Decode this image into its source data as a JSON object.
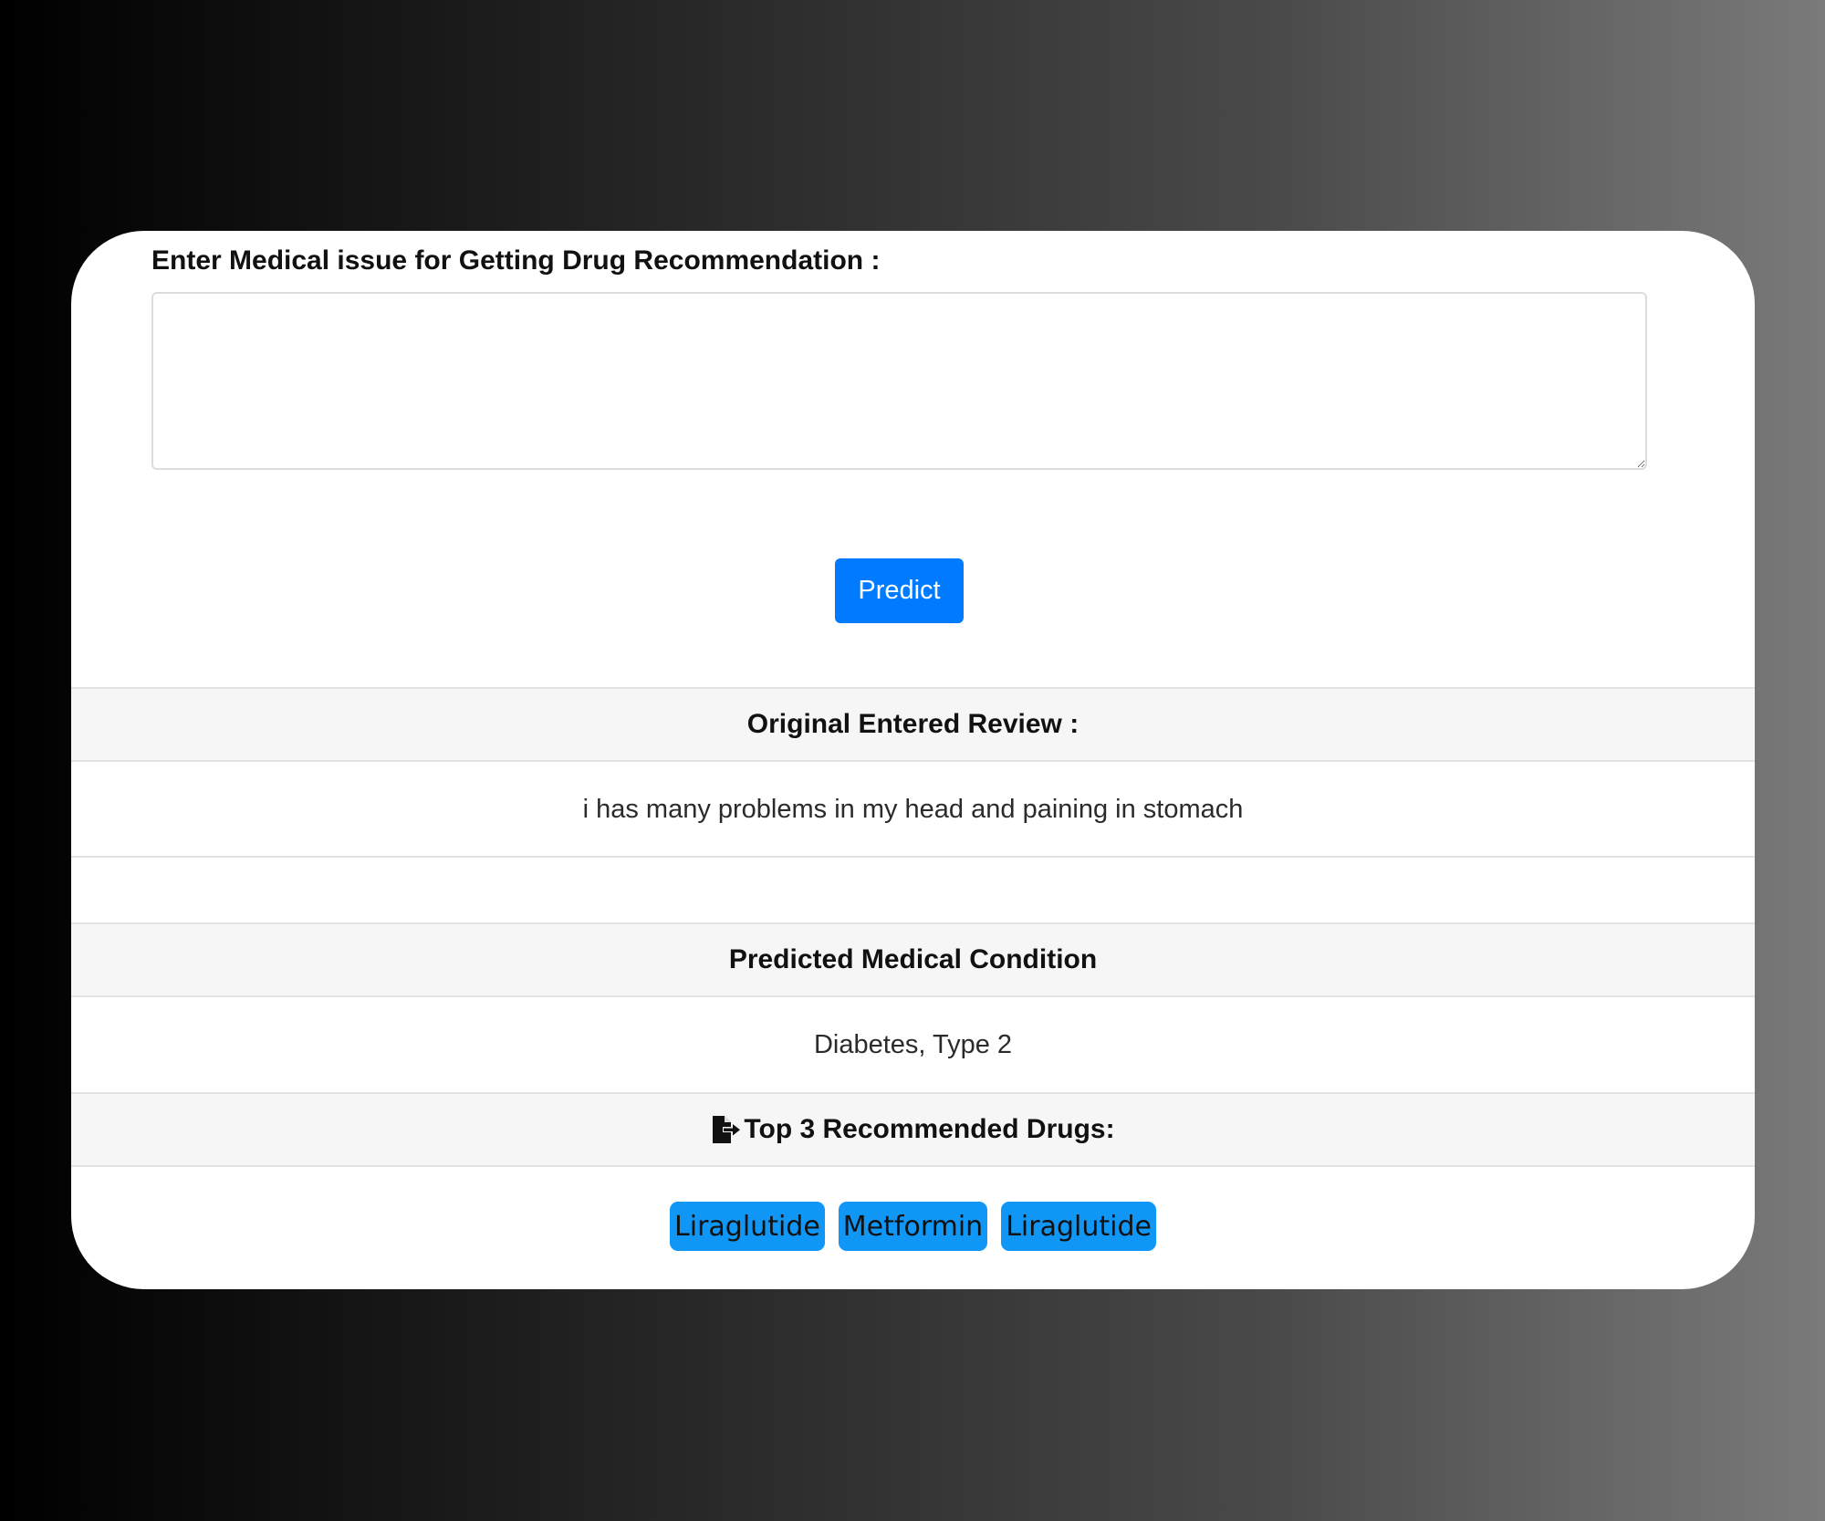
{
  "form": {
    "label": "Enter Medical issue for Getting Drug Recommendation :",
    "textarea_value": "",
    "submit_label": "Predict"
  },
  "review": {
    "header": "Original Entered Review :",
    "text": "i has many problems in my head and paining in stomach"
  },
  "condition": {
    "header": "Predicted Medical Condition",
    "value": "Diabetes, Type 2"
  },
  "drugs": {
    "header_icon": "file-export-icon",
    "header": "Top 3 Recommended Drugs:",
    "items": [
      "Liraglutide",
      "Metformin",
      "Liraglutide"
    ],
    "badge_color": "#1097f6"
  },
  "colors": {
    "primary_button": "#007bff",
    "section_header_bg": "#f6f6f6"
  }
}
